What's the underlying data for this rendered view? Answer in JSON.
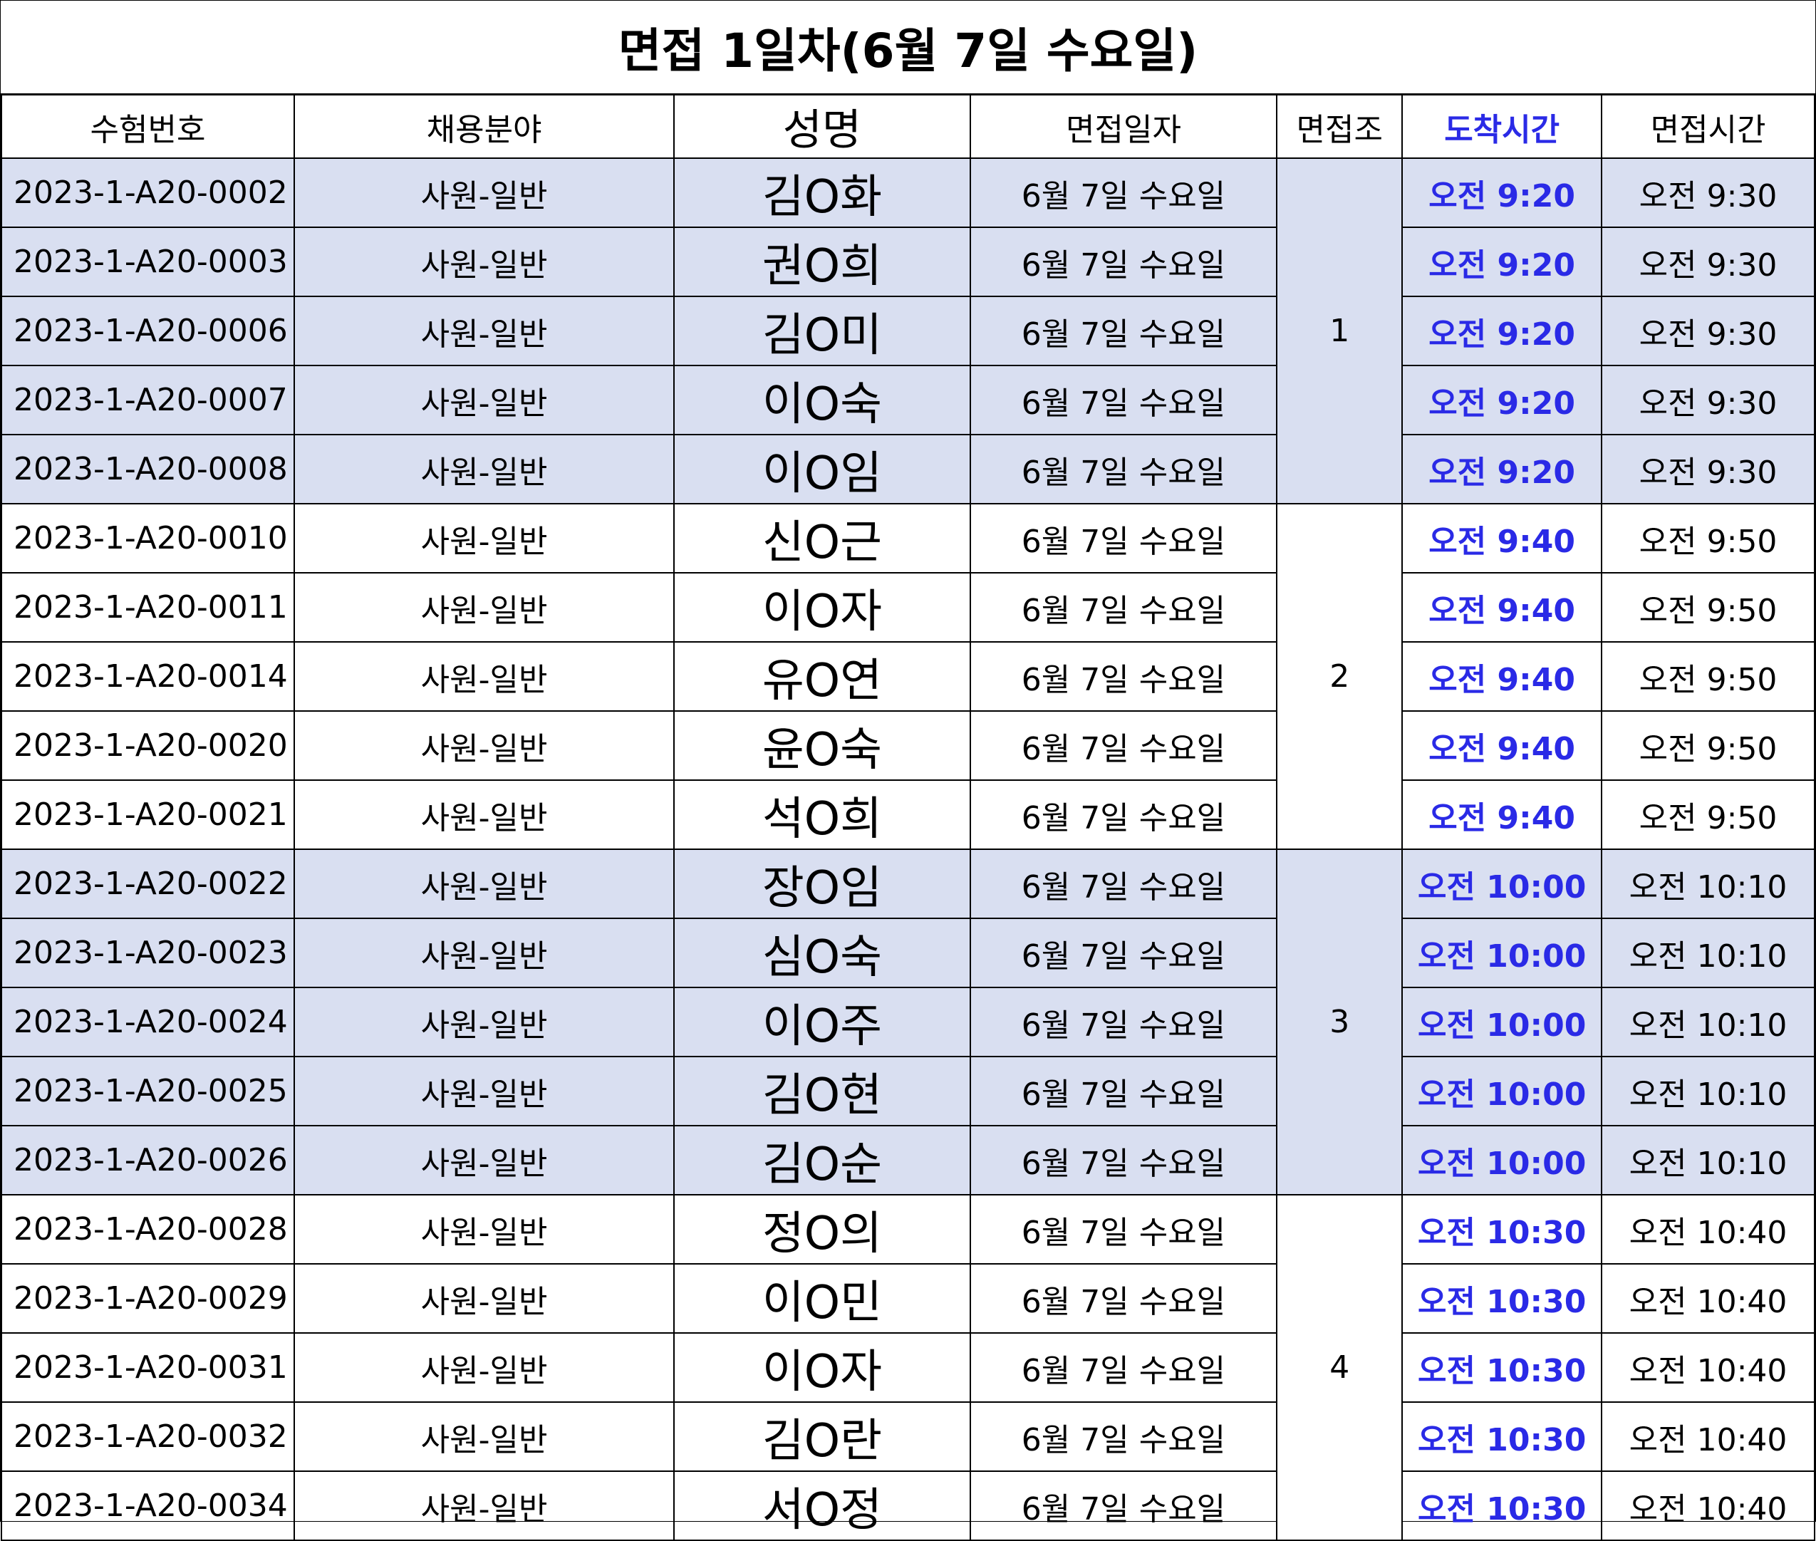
{
  "title": "면접 1일차(6월 7일 수요일)",
  "headers": {
    "exam_no": "수험번호",
    "field": "채용분야",
    "name": "성명",
    "date": "면접일자",
    "group": "면접조",
    "arrival": "도착시간",
    "interview_time": "면접시간"
  },
  "groups": [
    {
      "label": "1",
      "rows": [
        {
          "exam_no": "2023-1-A20-0002",
          "field": "사원-일반",
          "name": "김O화",
          "date": "6월 7일 수요일",
          "arrival": "오전 9:20",
          "interview_time": "오전 9:30"
        },
        {
          "exam_no": "2023-1-A20-0003",
          "field": "사원-일반",
          "name": "권O희",
          "date": "6월 7일 수요일",
          "arrival": "오전 9:20",
          "interview_time": "오전 9:30"
        },
        {
          "exam_no": "2023-1-A20-0006",
          "field": "사원-일반",
          "name": "김O미",
          "date": "6월 7일 수요일",
          "arrival": "오전 9:20",
          "interview_time": "오전 9:30"
        },
        {
          "exam_no": "2023-1-A20-0007",
          "field": "사원-일반",
          "name": "이O숙",
          "date": "6월 7일 수요일",
          "arrival": "오전 9:20",
          "interview_time": "오전 9:30"
        },
        {
          "exam_no": "2023-1-A20-0008",
          "field": "사원-일반",
          "name": "이O임",
          "date": "6월 7일 수요일",
          "arrival": "오전 9:20",
          "interview_time": "오전 9:30"
        }
      ]
    },
    {
      "label": "2",
      "rows": [
        {
          "exam_no": "2023-1-A20-0010",
          "field": "사원-일반",
          "name": "신O근",
          "date": "6월 7일 수요일",
          "arrival": "오전 9:40",
          "interview_time": "오전 9:50"
        },
        {
          "exam_no": "2023-1-A20-0011",
          "field": "사원-일반",
          "name": "이O자",
          "date": "6월 7일 수요일",
          "arrival": "오전 9:40",
          "interview_time": "오전 9:50"
        },
        {
          "exam_no": "2023-1-A20-0014",
          "field": "사원-일반",
          "name": "유O연",
          "date": "6월 7일 수요일",
          "arrival": "오전 9:40",
          "interview_time": "오전 9:50"
        },
        {
          "exam_no": "2023-1-A20-0020",
          "field": "사원-일반",
          "name": "윤O숙",
          "date": "6월 7일 수요일",
          "arrival": "오전 9:40",
          "interview_time": "오전 9:50"
        },
        {
          "exam_no": "2023-1-A20-0021",
          "field": "사원-일반",
          "name": "석O희",
          "date": "6월 7일 수요일",
          "arrival": "오전 9:40",
          "interview_time": "오전 9:50"
        }
      ]
    },
    {
      "label": "3",
      "rows": [
        {
          "exam_no": "2023-1-A20-0022",
          "field": "사원-일반",
          "name": "장O임",
          "date": "6월 7일 수요일",
          "arrival": "오전 10:00",
          "interview_time": "오전 10:10"
        },
        {
          "exam_no": "2023-1-A20-0023",
          "field": "사원-일반",
          "name": "심O숙",
          "date": "6월 7일 수요일",
          "arrival": "오전 10:00",
          "interview_time": "오전 10:10"
        },
        {
          "exam_no": "2023-1-A20-0024",
          "field": "사원-일반",
          "name": "이O주",
          "date": "6월 7일 수요일",
          "arrival": "오전 10:00",
          "interview_time": "오전 10:10"
        },
        {
          "exam_no": "2023-1-A20-0025",
          "field": "사원-일반",
          "name": "김O현",
          "date": "6월 7일 수요일",
          "arrival": "오전 10:00",
          "interview_time": "오전 10:10"
        },
        {
          "exam_no": "2023-1-A20-0026",
          "field": "사원-일반",
          "name": "김O순",
          "date": "6월 7일 수요일",
          "arrival": "오전 10:00",
          "interview_time": "오전 10:10"
        }
      ]
    },
    {
      "label": "4",
      "rows": [
        {
          "exam_no": "2023-1-A20-0028",
          "field": "사원-일반",
          "name": "정O의",
          "date": "6월 7일 수요일",
          "arrival": "오전 10:30",
          "interview_time": "오전 10:40"
        },
        {
          "exam_no": "2023-1-A20-0029",
          "field": "사원-일반",
          "name": "이O민",
          "date": "6월 7일 수요일",
          "arrival": "오전 10:30",
          "interview_time": "오전 10:40"
        },
        {
          "exam_no": "2023-1-A20-0031",
          "field": "사원-일반",
          "name": "이O자",
          "date": "6월 7일 수요일",
          "arrival": "오전 10:30",
          "interview_time": "오전 10:40"
        },
        {
          "exam_no": "2023-1-A20-0032",
          "field": "사원-일반",
          "name": "김O란",
          "date": "6월 7일 수요일",
          "arrival": "오전 10:30",
          "interview_time": "오전 10:40"
        },
        {
          "exam_no": "2023-1-A20-0034",
          "field": "사원-일반",
          "name": "서O정",
          "date": "6월 7일 수요일",
          "arrival": "오전 10:30",
          "interview_time": "오전 10:40"
        }
      ]
    }
  ],
  "colors": {
    "shade": "#d9dff1",
    "arrival_text": "#2a2ae6"
  }
}
